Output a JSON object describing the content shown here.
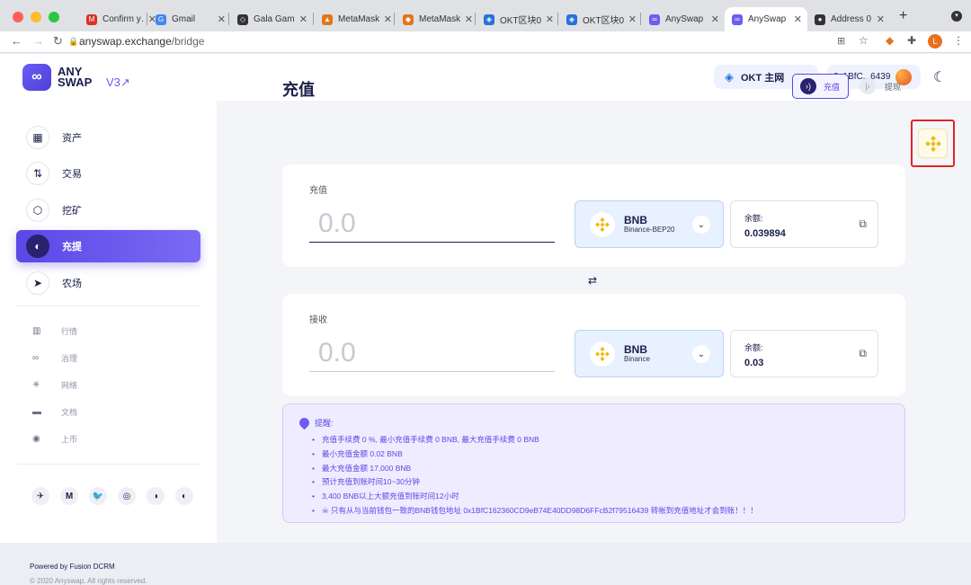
{
  "browser": {
    "tabs": [
      {
        "label": "Confirm y…",
        "icon": "M",
        "color": "#d93025"
      },
      {
        "label": "Gmail",
        "icon": "G",
        "color": "#4285f4"
      },
      {
        "label": "Gala Game",
        "icon": "◇",
        "color": "#333"
      },
      {
        "label": "MetaMask",
        "icon": "▲",
        "color": "#e2761b"
      },
      {
        "label": "MetaMask",
        "icon": "◆",
        "color": "#e2761b"
      },
      {
        "label": "OKT区块0",
        "icon": "◈",
        "color": "#2a6fdb"
      },
      {
        "label": "OKT区块0",
        "icon": "◈",
        "color": "#2a6fdb"
      },
      {
        "label": "AnySwap",
        "icon": "∞",
        "color": "#6c5cf6"
      },
      {
        "label": "AnySwap",
        "icon": "∞",
        "color": "#6c5cf6"
      },
      {
        "label": "Address 0",
        "icon": "●",
        "color": "#333"
      }
    ],
    "url_host": "anyswap.exchange",
    "url_path": "/bridge"
  },
  "header": {
    "logo_line1": "ANY",
    "logo_line2": "SWAP",
    "version": "V3↗",
    "network": "OKT 主网",
    "account": "0x1BfC...6439"
  },
  "sidebar": {
    "items": [
      {
        "label": "资产",
        "icon": "▦"
      },
      {
        "label": "交易",
        "icon": "⇅"
      },
      {
        "label": "挖矿",
        "icon": "⬡"
      },
      {
        "label": "充提",
        "icon": "◐"
      },
      {
        "label": "农场",
        "icon": "➤"
      }
    ],
    "subs": [
      {
        "label": "行情",
        "icon": "▥"
      },
      {
        "label": "治理",
        "icon": "∞"
      },
      {
        "label": "网络",
        "icon": "✳"
      },
      {
        "label": "文档",
        "icon": "▬"
      },
      {
        "label": "上币",
        "icon": "◉"
      }
    ],
    "social": [
      "✈",
      "M",
      "🐦",
      "◎",
      "◑",
      "◐"
    ],
    "powered": "Powered by Fusion DCRM",
    "copyright": "© 2020 Anyswap. All rights reserved."
  },
  "main": {
    "title": "充值",
    "deposit_tab": "充值",
    "withdraw_tab": "提现",
    "from": {
      "label": "充值",
      "amount_placeholder": "0.0",
      "token": "BNB",
      "chain": "Binance-BEP20",
      "balance_label": "余额:",
      "balance": "0.039894"
    },
    "to": {
      "label": "接收",
      "amount_placeholder": "0.0",
      "token": "BNB",
      "chain": "Binance",
      "balance_label": "余额:",
      "balance": "0.03"
    },
    "notice": {
      "title": "提醒:",
      "lines": [
        "充值手续费 0 %, 最小充值手续费 0 BNB, 最大充值手续费 0 BNB",
        "最小充值金额 0.02 BNB",
        "最大充值金额 17,000 BNB",
        "预计充值到账时间10~30分钟",
        "3,400 BNB以上大额充值到账时间12小时",
        "☠ 只有从与当前钱包一致的BNB钱包地址 0x1BfC162360CD9eB74E40DD98D6FFcB2f79516439 转帐到充值地址才会到账！！！"
      ]
    }
  }
}
